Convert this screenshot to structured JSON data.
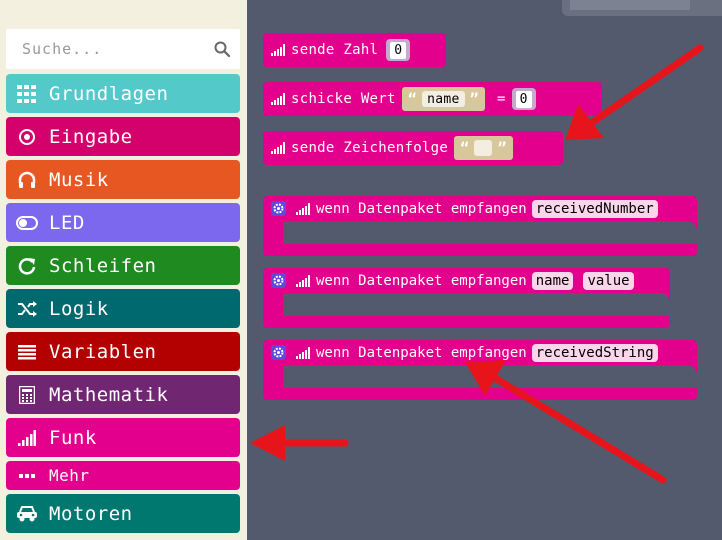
{
  "search": {
    "placeholder": "Suche..."
  },
  "categories": [
    {
      "label": "Grundlagen",
      "color": "#54c9c9",
      "icon": "grid-icon"
    },
    {
      "label": "Eingabe",
      "color": "#d4006b",
      "icon": "target-icon"
    },
    {
      "label": "Musik",
      "color": "#e65722",
      "icon": "headphones-icon"
    },
    {
      "label": "LED",
      "color": "#7b68ee",
      "icon": "toggle-icon"
    },
    {
      "label": "Schleifen",
      "color": "#1f8a1f",
      "icon": "refresh-icon"
    },
    {
      "label": "Logik",
      "color": "#006970",
      "icon": "shuffle-icon"
    },
    {
      "label": "Variablen",
      "color": "#b30000",
      "icon": "list-icon"
    },
    {
      "label": "Mathematik",
      "color": "#712672",
      "icon": "calculator-icon"
    },
    {
      "label": "Funk",
      "color": "#e3008c",
      "icon": "signal-icon"
    },
    {
      "label": "Mehr",
      "color": "#e3008c",
      "icon": "more-icon"
    },
    {
      "label": "Motoren",
      "color": "#00786f",
      "icon": "car-icon"
    }
  ],
  "blocks": {
    "send_number": {
      "label": "sende Zahl",
      "value": "0"
    },
    "send_value": {
      "label": "schicke Wert",
      "name": "name",
      "eq": "=",
      "value": "0"
    },
    "send_string": {
      "label": "sende Zeichenfolge",
      "value": ""
    },
    "on_number": {
      "label": "wenn Datenpaket empfangen",
      "param": "receivedNumber"
    },
    "on_value": {
      "label": "wenn Datenpaket empfangen",
      "param1": "name",
      "param2": "value"
    },
    "on_string": {
      "label": "wenn Datenpaket empfangen",
      "param": "receivedString"
    }
  },
  "quote_open": "“",
  "quote_close": "”",
  "annotation_color": "#e8141c"
}
